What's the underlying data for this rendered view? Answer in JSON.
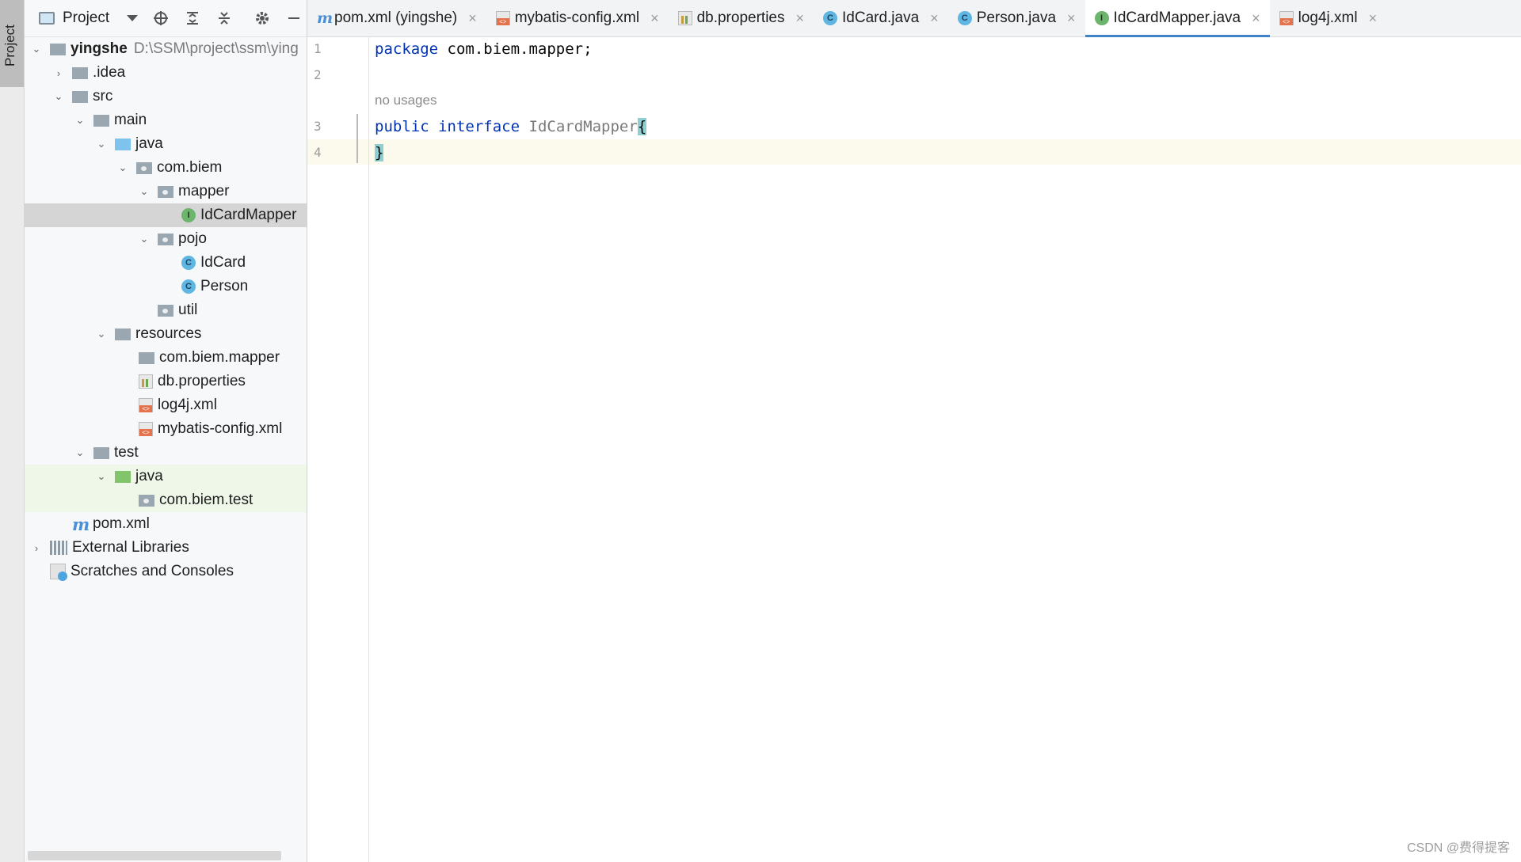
{
  "sidestrip": {
    "label": "Project"
  },
  "panel": {
    "title": "Project"
  },
  "tree": {
    "root_name": "yingshe",
    "root_path": "D:\\SSM\\project\\ssm\\ying",
    "idea": ".idea",
    "src": "src",
    "main": "main",
    "java": "java",
    "com_biem": "com.biem",
    "mapper": "mapper",
    "idcardmapper": "IdCardMapper",
    "pojo": "pojo",
    "idcard": "IdCard",
    "person": "Person",
    "util": "util",
    "resources": "resources",
    "com_biem_mapper": "com.biem.mapper",
    "db_properties": "db.properties",
    "log4j": "log4j.xml",
    "mybatis_config": "mybatis-config.xml",
    "test": "test",
    "test_java": "java",
    "com_biem_test": "com.biem.test",
    "pom": "pom.xml",
    "external_libraries": "External Libraries",
    "scratches": "Scratches and Consoles"
  },
  "tabs": [
    {
      "label": "pom.xml (yingshe)",
      "icon": "maven-icon"
    },
    {
      "label": "mybatis-config.xml",
      "icon": "xml-icon"
    },
    {
      "label": "db.properties",
      "icon": "properties-icon"
    },
    {
      "label": "IdCard.java",
      "icon": "class-icon"
    },
    {
      "label": "Person.java",
      "icon": "class-icon"
    },
    {
      "label": "IdCardMapper.java",
      "icon": "interface-icon",
      "active": true
    },
    {
      "label": "log4j.xml",
      "icon": "xml-icon"
    }
  ],
  "tab_close": "×",
  "editor": {
    "line_numbers": [
      "1",
      "2",
      "3",
      "4"
    ],
    "line1_kw": "package",
    "line1_rest": " com.biem.mapper;",
    "inlay": "no usages",
    "line3_kw1": "public",
    "line3_kw2": "interface",
    "line3_name": "IdCardMapper",
    "line3_brace": "{",
    "line4_brace": "}"
  },
  "watermark": "CSDN @费得提客",
  "colors": {
    "keyword": "#0033b3",
    "accent": "#4083c9",
    "current_line": "#fcfaed"
  }
}
